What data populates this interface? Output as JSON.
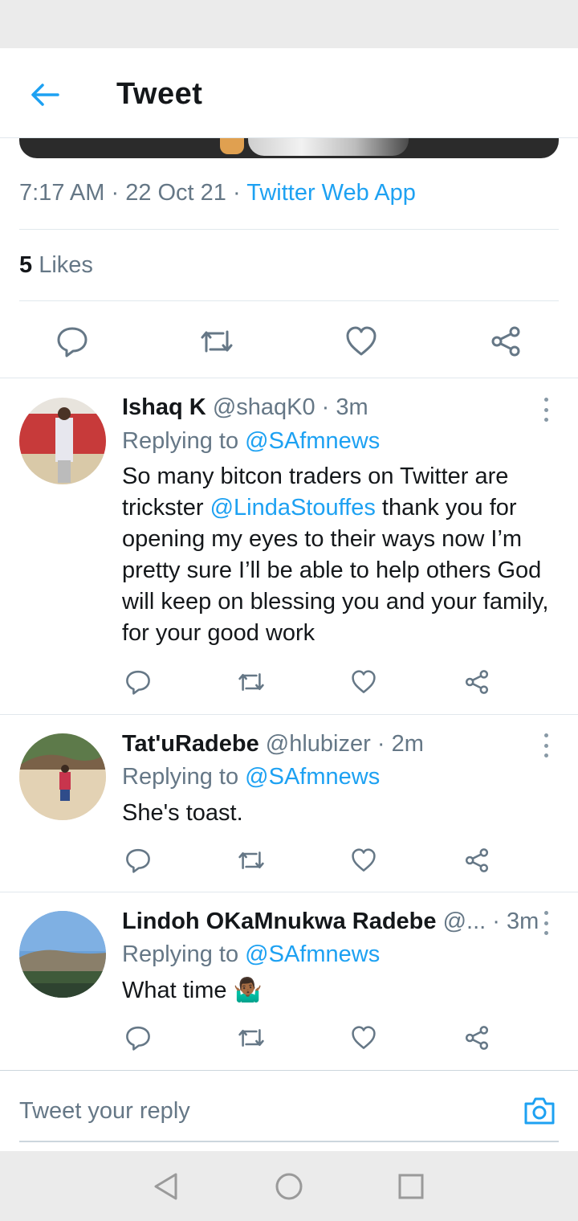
{
  "header": {
    "title": "Tweet"
  },
  "tweet": {
    "time": "7:17 AM",
    "date": "22 Oct 21",
    "source": "Twitter Web App",
    "likes_count": "5",
    "likes_label": "Likes"
  },
  "replies": [
    {
      "name": "Ishaq K",
      "handle": "@shaqK0",
      "age": "3m",
      "replying_prefix": "Replying to",
      "replying_to": "@SAfmnews",
      "text_before": "So many bitcon traders on Twitter are trickster ",
      "mention": "@LindaStouffes",
      "text_after": " thank you for opening my eyes to their ways now I’m pretty sure I’ll be able to help others God will keep on blessing you and your family, for your good work"
    },
    {
      "name": "Tat'uRadebe",
      "handle": "@hlubizer",
      "age": "2m",
      "replying_prefix": "Replying to",
      "replying_to": "@SAfmnews",
      "text": "She's toast."
    },
    {
      "name": "Lindoh OKaMnukwa Radebe",
      "handle": "@...",
      "age": "3m",
      "replying_prefix": "Replying to",
      "replying_to": "@SAfmnews",
      "text": "What time",
      "emoji": "🤷🏾‍♂️"
    }
  ],
  "compose": {
    "placeholder": "Tweet your reply"
  },
  "icons": {
    "back": "arrow-left-icon",
    "reply": "speech-bubble-icon",
    "retweet": "retweet-icon",
    "like": "heart-icon",
    "share": "share-icon",
    "more": "more-vertical-icon",
    "camera": "camera-icon",
    "nav_back": "triangle-back-icon",
    "nav_home": "circle-home-icon",
    "nav_recents": "square-recents-icon"
  },
  "colors": {
    "accent": "#1da1f2",
    "text": "#14171a",
    "secondary": "#657786",
    "divider": "#e1e8ed"
  }
}
